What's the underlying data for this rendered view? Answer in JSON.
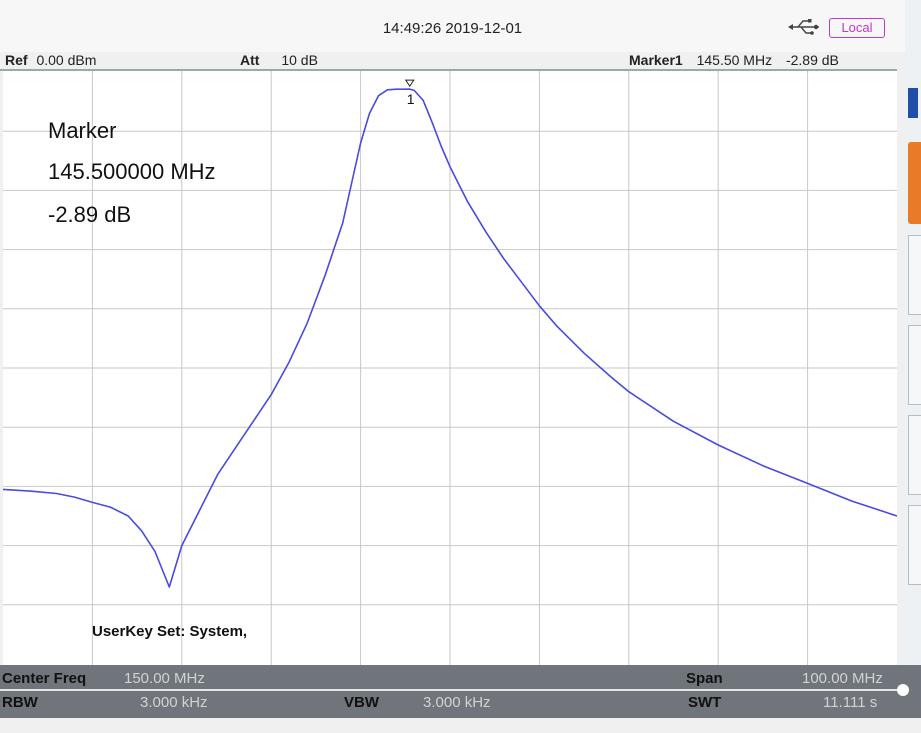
{
  "status": {
    "datetime": "14:49:26 2019-12-01",
    "remote_mode": "Local",
    "usb_icon": "usb-icon"
  },
  "header": {
    "ref_label": "Ref",
    "ref_value": "0.00 dBm",
    "att_label": "Att",
    "att_value": "10 dB",
    "marker_label": "Marker1",
    "marker_freq": "145.50 MHz",
    "marker_level": "-2.89 dB"
  },
  "marker_info": {
    "title": "Marker",
    "frequency": "145.500000 MHz",
    "level": "-2.89 dB",
    "marker_number": "1"
  },
  "userkey": {
    "text": "UserKey Set:   System,"
  },
  "footer": {
    "center_label": "Center Freq",
    "center_value": "150.00 MHz",
    "span_label": "Span",
    "span_value": "100.00 MHz",
    "rbw_label": "RBW",
    "rbw_value": "3.000 kHz",
    "vbw_label": "VBW",
    "vbw_value": "3.000 kHz",
    "swt_label": "SWT",
    "swt_value": "11.111 s"
  },
  "colors": {
    "trace": "#4a4ae0",
    "grid": "#c8c8c8",
    "plot_bg": "#ffffff",
    "footer_bg": "#6f757b",
    "local_badge": "#c238c8",
    "side_accent": "#e87a28"
  },
  "chart_data": {
    "type": "line",
    "x_unit": "MHz",
    "y_unit": "dB",
    "xlim": [
      100,
      200
    ],
    "ylim": [
      -100,
      0
    ],
    "grid": true,
    "series": [
      {
        "x": [
          100,
          103,
          106,
          108,
          110,
          112,
          114,
          115.5,
          117,
          118.6,
          120,
          122,
          124,
          126,
          128,
          130,
          132,
          134,
          136,
          138,
          140,
          141,
          142,
          143,
          144,
          145,
          145.5,
          146,
          147,
          148,
          149,
          150,
          151,
          152,
          154,
          156,
          158,
          160,
          162,
          165,
          168,
          170,
          175,
          180,
          185,
          190,
          195,
          200
        ],
        "y": [
          -70.5,
          -70.8,
          -71.2,
          -71.8,
          -72.7,
          -73.5,
          -75,
          -77.5,
          -81,
          -87,
          -80,
          -74,
          -68,
          -63.5,
          -59,
          -54.5,
          -49,
          -42.5,
          -34.5,
          -25.5,
          -12,
          -7,
          -4,
          -3,
          -2.9,
          -2.9,
          -2.89,
          -3.1,
          -4.8,
          -8.5,
          -12.5,
          -16,
          -19,
          -22,
          -27,
          -31.5,
          -35.5,
          -39.5,
          -43,
          -47.5,
          -51.5,
          -54,
          -59,
          -63,
          -66.5,
          -69.5,
          -72.5,
          -75
        ]
      }
    ]
  }
}
